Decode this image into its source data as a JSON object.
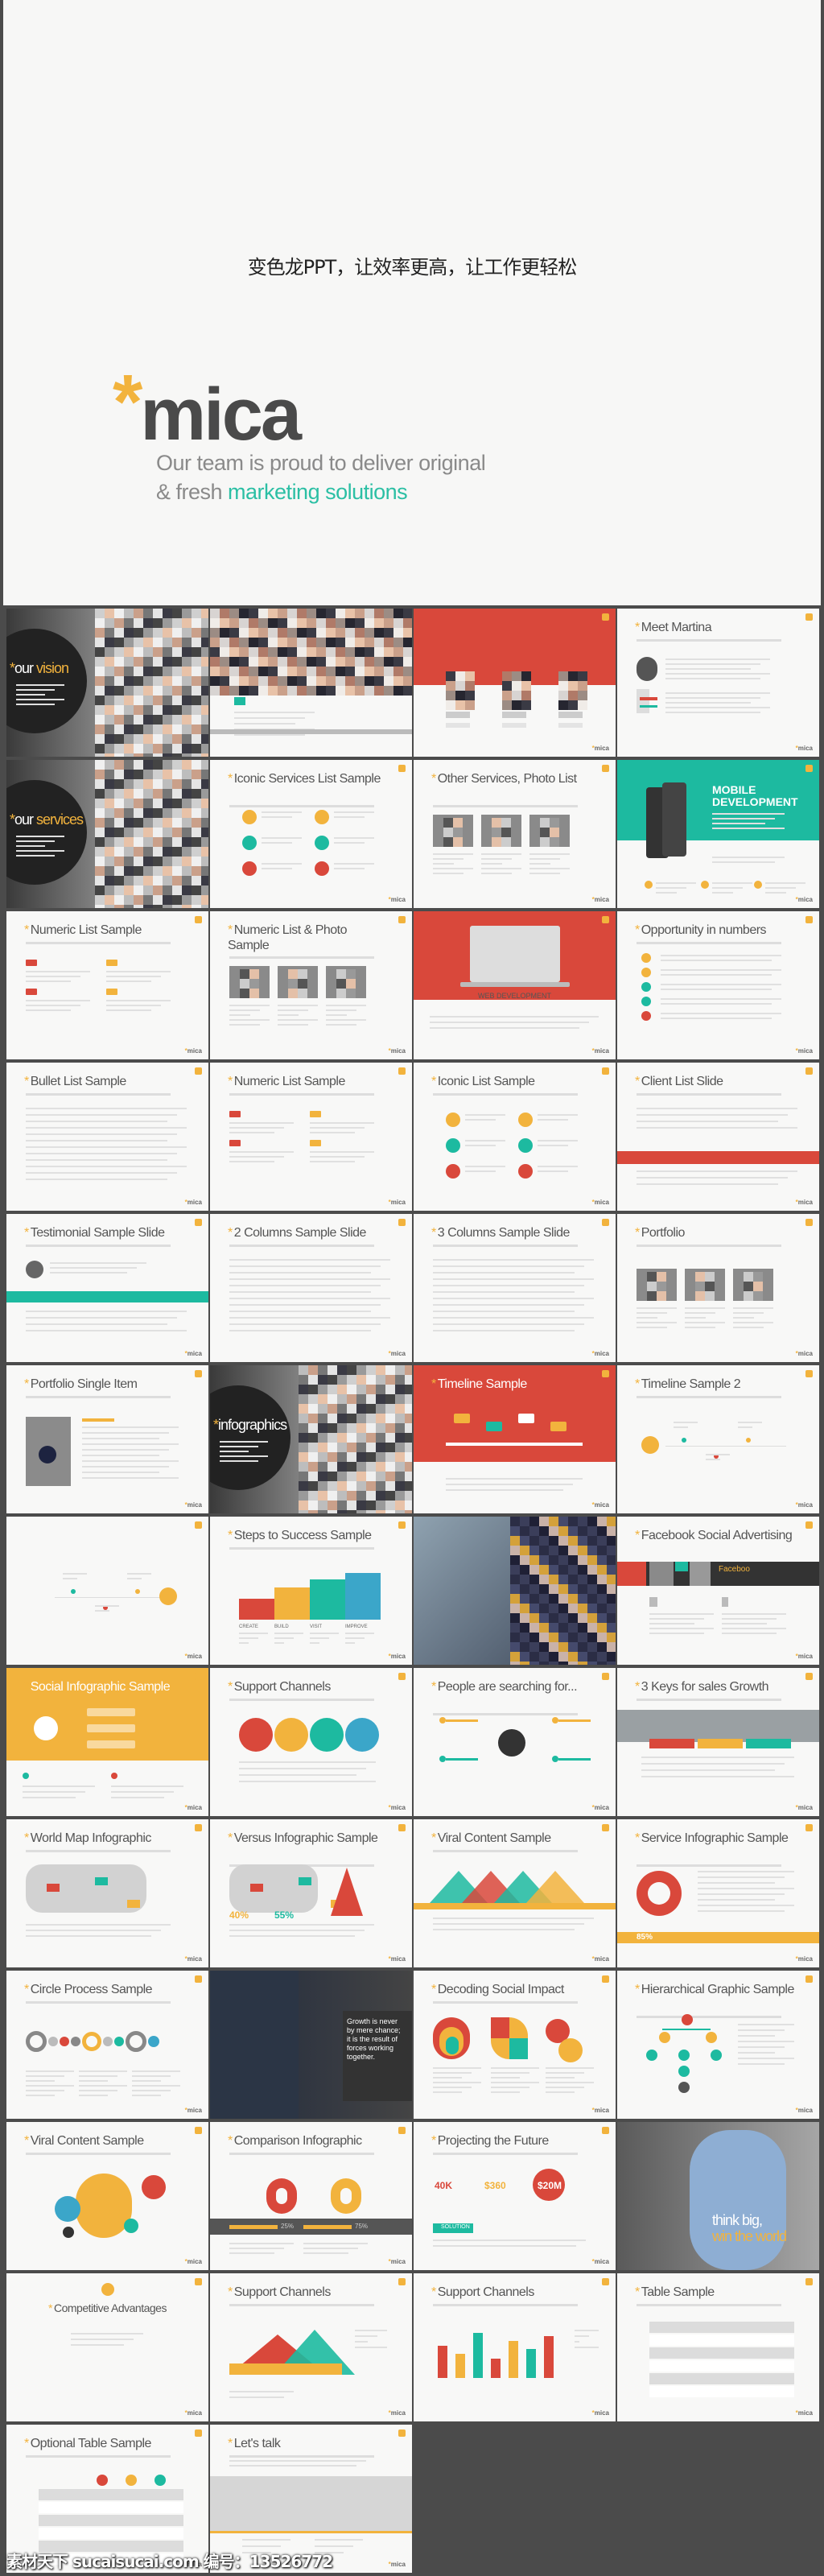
{
  "hero": {
    "cn_title": "变色龙PPT，让效率更高，让工作更轻松",
    "logo": "mica",
    "logo_mark": "*",
    "tagline1": "Our team is proud to deliver original",
    "tagline2_plain": "& fresh ",
    "tagline2_highlight": "marketing solutions"
  },
  "colors": {
    "yellow": "#f2b33d",
    "teal": "#1dbaa0",
    "red": "#d9483b",
    "blue": "#3ba6c9",
    "gray": "#555555",
    "background": "#4b4b4b"
  },
  "slide_logo": "mica",
  "slides": [
    {
      "title": "",
      "variant": "photo-circle",
      "circle_white": "our ",
      "circle_yellow": "vision"
    },
    {
      "title": "",
      "variant": "collage"
    },
    {
      "title": "",
      "variant": "red-team"
    },
    {
      "title": "Meet Martina",
      "variant": "white",
      "decor": "profile"
    },
    {
      "title": "",
      "variant": "photo-circle",
      "circle_white": "our ",
      "circle_yellow": "services"
    },
    {
      "title": "Iconic Services List Sample",
      "variant": "white",
      "decor": "icons"
    },
    {
      "title": "Other Services, Photo List",
      "variant": "white",
      "decor": "photos"
    },
    {
      "title": "MOBILE DEVELOPMENT",
      "variant": "teal"
    },
    {
      "title": "Numeric List Sample",
      "variant": "white",
      "decor": "numeric"
    },
    {
      "title": "Numeric List & Photo Sample",
      "variant": "white",
      "decor": "photos"
    },
    {
      "title": "WEB DEVELOPMENT",
      "variant": "red-laptop"
    },
    {
      "title": "Opportunity in numbers",
      "variant": "white",
      "decor": "icons-list"
    },
    {
      "title": "Bullet List Sample",
      "variant": "white",
      "decor": "lines"
    },
    {
      "title": "Numeric List Sample",
      "variant": "white",
      "decor": "numeric"
    },
    {
      "title": "Iconic List Sample",
      "variant": "white",
      "decor": "icons"
    },
    {
      "title": "Client List Slide",
      "variant": "white",
      "decor": "redband"
    },
    {
      "title": "Testimonial Sample Slide",
      "variant": "white",
      "decor": "tealband"
    },
    {
      "title": "2 Columns Sample Slide",
      "variant": "white",
      "decor": "lines"
    },
    {
      "title": "3 Columns Sample Slide",
      "variant": "white",
      "decor": "lines"
    },
    {
      "title": "Portfolio",
      "variant": "white",
      "decor": "photos"
    },
    {
      "title": "Portfolio Single Item",
      "variant": "white",
      "decor": "single-photo"
    },
    {
      "title": "",
      "variant": "photo-circle",
      "circle_white": "",
      "circle_yellow": "infographics"
    },
    {
      "title": "Timeline Sample",
      "variant": "red-top"
    },
    {
      "title": "Timeline Sample 2",
      "variant": "white",
      "decor": "timeline"
    },
    {
      "title": "",
      "variant": "white",
      "decor": "timeline"
    },
    {
      "title": "Steps to Success Sample",
      "variant": "white",
      "decor": "steps",
      "steps": [
        "CREATE",
        "BUILD",
        "VISIT",
        "IMPROVE"
      ]
    },
    {
      "title": "",
      "variant": "photo"
    },
    {
      "title": "Facebook Social Advertising",
      "variant": "white",
      "decor": "facebook",
      "band_label": "Faceboo"
    },
    {
      "title": "Social Infographic Sample",
      "variant": "yellow"
    },
    {
      "title": "Support Channels",
      "variant": "white",
      "decor": "channels"
    },
    {
      "title": "People are searching for...",
      "variant": "white",
      "decor": "hub"
    },
    {
      "title": "3 Keys for sales Growth",
      "variant": "white",
      "decor": "city"
    },
    {
      "title": "World Map Infographic",
      "variant": "white",
      "decor": "map"
    },
    {
      "title": "Versus Infographic Sample",
      "variant": "white",
      "decor": "versus",
      "values": [
        "40%",
        "55%"
      ]
    },
    {
      "title": "Viral Content Sample",
      "variant": "white",
      "decor": "mountains"
    },
    {
      "title": "Service Infographic Sample",
      "variant": "white",
      "decor": "donut",
      "value": "85%"
    },
    {
      "title": "Circle Process Sample",
      "variant": "white",
      "decor": "process"
    },
    {
      "title": "",
      "variant": "photo-quote",
      "quote": "Growth is never by mere chance; it is the result of forces working together."
    },
    {
      "title": "Decoding Social Impact",
      "variant": "white",
      "decor": "pies"
    },
    {
      "title": "Hierarchical Graphic Sample",
      "variant": "white",
      "decor": "tree"
    },
    {
      "title": "Viral Content Sample",
      "variant": "white",
      "decor": "bubbles"
    },
    {
      "title": "Comparison Infographic",
      "variant": "white",
      "decor": "compare",
      "values": [
        "25%",
        "75%"
      ]
    },
    {
      "title": "Projecting the Future",
      "variant": "white",
      "decor": "formula",
      "values": [
        "40K",
        "$360",
        "$20M"
      ],
      "button": "SOLUTION"
    },
    {
      "title": "",
      "variant": "photo-think",
      "line1": "think big,",
      "line2": "win the world"
    },
    {
      "title": "Competitive Advantages",
      "variant": "white",
      "decor": "check"
    },
    {
      "title": "Support Channels",
      "variant": "white",
      "decor": "area"
    },
    {
      "title": "Support Channels",
      "variant": "white",
      "decor": "bars"
    },
    {
      "title": "Table Sample",
      "variant": "white",
      "decor": "table"
    },
    {
      "title": "Optional Table Sample",
      "variant": "white",
      "decor": "table"
    },
    {
      "title": "Let's talk",
      "variant": "white",
      "decor": "mapstrip"
    }
  ],
  "watermark": "素材天下 sucaisucai.com 编号：13526772"
}
